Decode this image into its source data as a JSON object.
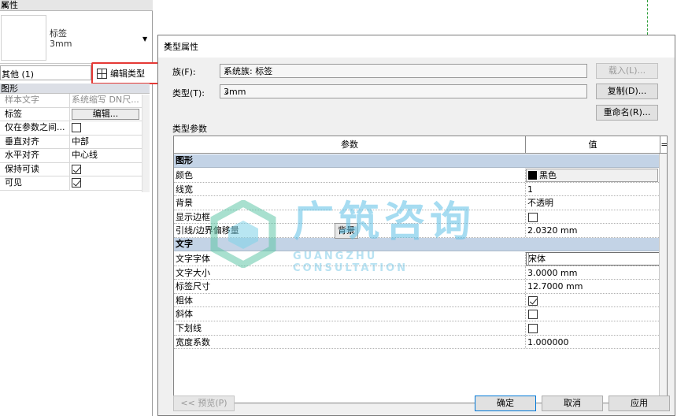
{
  "properties_palette": {
    "title": "属性",
    "type_name_line1": "标签",
    "type_name_line2": "3mm",
    "filter_label": "其他 (1)",
    "edit_type_label": "编辑类型",
    "category": "图形",
    "rows": [
      {
        "name": "样本文字",
        "value": "系统缩写 DN尺..."
      },
      {
        "name": "标签",
        "value": "编辑..."
      },
      {
        "name": "仅在参数之间...",
        "value": ""
      },
      {
        "name": "垂直对齐",
        "value": "中部"
      },
      {
        "name": "水平对齐",
        "value": "中心线"
      },
      {
        "name": "保持可读",
        "value": ""
      },
      {
        "name": "可见",
        "value": ""
      }
    ]
  },
  "dialog": {
    "title": "类型属性",
    "family_label": "族(F):",
    "family_value": "系统族: 标签",
    "type_label": "类型(T):",
    "type_value": "3mm",
    "load_button": "载入(L)...",
    "duplicate_button": "复制(D)...",
    "rename_button": "重命名(R)...",
    "type_params_label": "类型参数",
    "col_param": "参数",
    "col_value": "值",
    "col_eq": "=",
    "groups": [
      {
        "name": "图形",
        "rows": [
          {
            "name": "颜色",
            "value": "黑色"
          },
          {
            "name": "线宽",
            "value": "1"
          },
          {
            "name": "背景",
            "value": "不透明"
          },
          {
            "name": "显示边框",
            "value": ""
          },
          {
            "name": "引线/边界偏移量",
            "value": "2.0320 mm"
          }
        ]
      },
      {
        "name": "文字",
        "rows": [
          {
            "name": "文字字体",
            "value": "宋体"
          },
          {
            "name": "文字大小",
            "value": "3.0000 mm"
          },
          {
            "name": "标签尺寸",
            "value": "12.7000 mm"
          },
          {
            "name": "粗体",
            "value": ""
          },
          {
            "name": "斜体",
            "value": ""
          },
          {
            "name": "下划线",
            "value": ""
          },
          {
            "name": "宽度系数",
            "value": "1.000000"
          }
        ]
      }
    ],
    "tooltip": "背景",
    "preview_button": "<< 预览(P)",
    "ok_button": "确定",
    "cancel_button": "取消",
    "apply_button": "应用"
  },
  "watermark": {
    "text": "广筑咨询",
    "subtext": "GUANGZHU CONSULTATION"
  },
  "colors": {
    "category_bg": "#c3d3e6",
    "highlight_border": "#e53935",
    "watermark": "#5fc1e6"
  }
}
